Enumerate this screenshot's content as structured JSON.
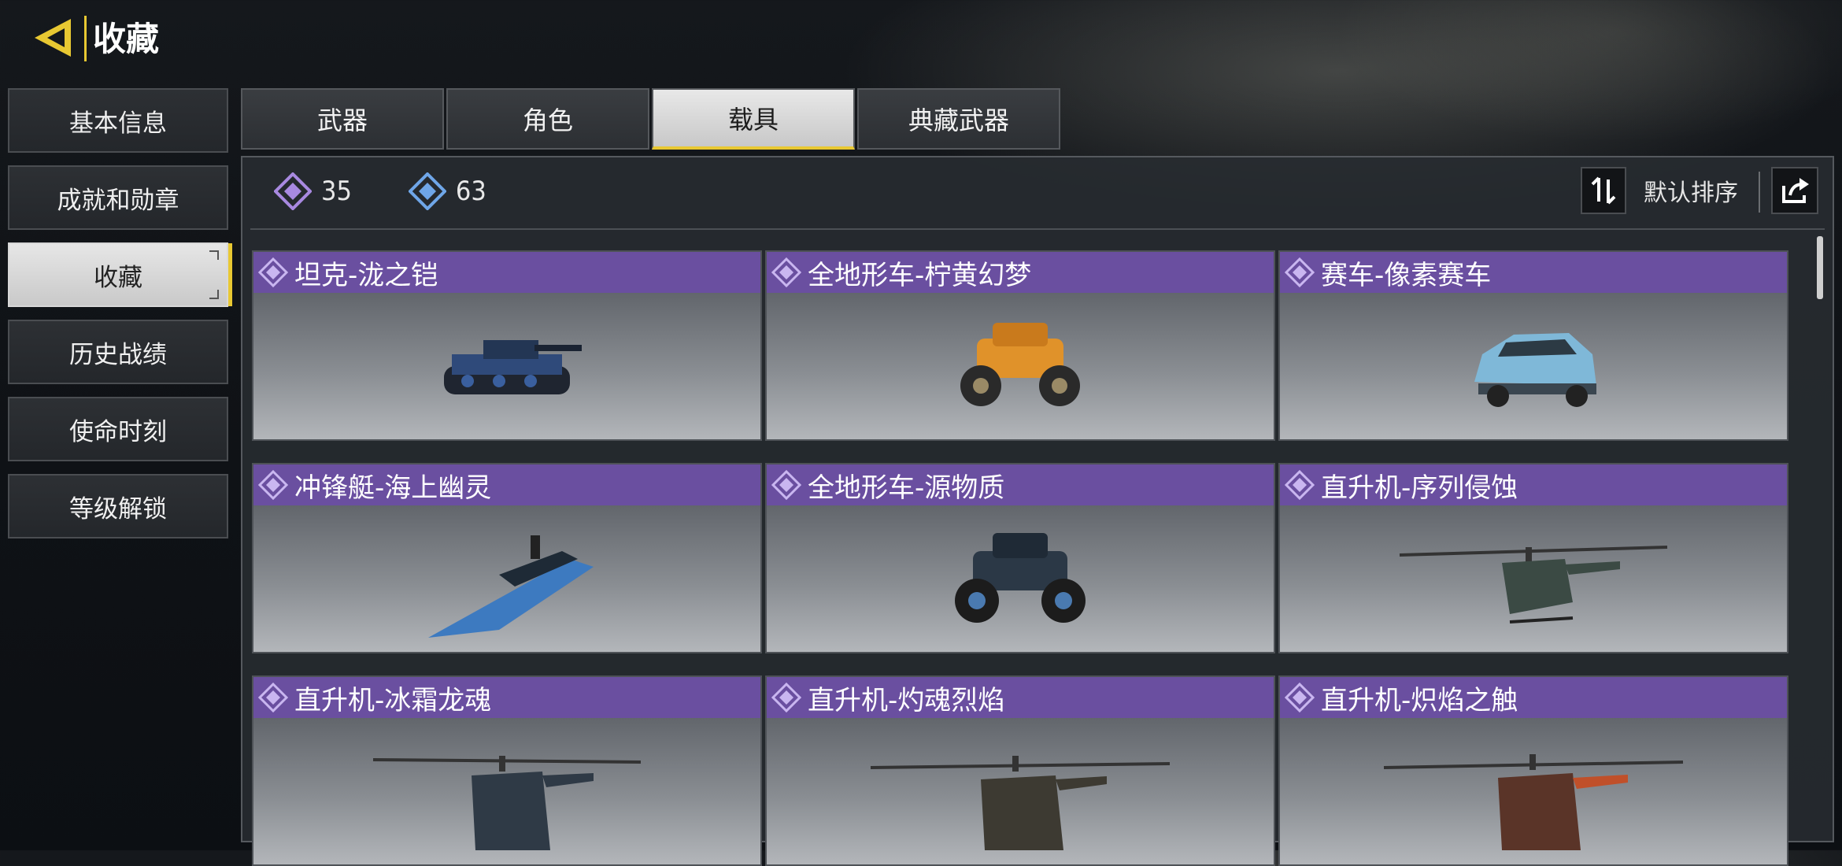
{
  "header": {
    "title": "收藏",
    "accent": "#e8c832"
  },
  "sidebar": {
    "items": [
      {
        "label": "基本信息",
        "active": false
      },
      {
        "label": "成就和勋章",
        "active": false
      },
      {
        "label": "收藏",
        "active": true
      },
      {
        "label": "历史战绩",
        "active": false
      },
      {
        "label": "使命时刻",
        "active": false
      },
      {
        "label": "等级解锁",
        "active": false
      }
    ]
  },
  "tabs": [
    {
      "label": "武器",
      "active": false
    },
    {
      "label": "角色",
      "active": false
    },
    {
      "label": "载具",
      "active": true
    },
    {
      "label": "典藏武器",
      "active": false
    }
  ],
  "currencies": [
    {
      "icon": "purple-diamond-icon",
      "value": "35",
      "color": "#a889e0"
    },
    {
      "icon": "blue-diamond-icon",
      "value": "63",
      "color": "#6fa6e8"
    }
  ],
  "sort": {
    "label": "默认排序"
  },
  "items": [
    {
      "name": "坦克-泷之铠",
      "vehicle": "tank",
      "rarity_color": "#6a4fa0"
    },
    {
      "name": "全地形车-柠黄幻梦",
      "vehicle": "atv-orange",
      "rarity_color": "#6a4fa0"
    },
    {
      "name": "赛车-像素赛车",
      "vehicle": "race-car",
      "rarity_color": "#6a4fa0"
    },
    {
      "name": "冲锋艇-海上幽灵",
      "vehicle": "boat",
      "rarity_color": "#6a4fa0"
    },
    {
      "name": "全地形车-源物质",
      "vehicle": "atv-dark",
      "rarity_color": "#6a4fa0"
    },
    {
      "name": "直升机-序列侵蚀",
      "vehicle": "helicopter-green",
      "rarity_color": "#6a4fa0"
    },
    {
      "name": "直升机-冰霜龙魂",
      "vehicle": "helicopter-blue",
      "rarity_color": "#6a4fa0"
    },
    {
      "name": "直升机-灼魂烈焰",
      "vehicle": "helicopter-gold",
      "rarity_color": "#6a4fa0"
    },
    {
      "name": "直升机-炽焰之触",
      "vehicle": "helicopter-red",
      "rarity_color": "#6a4fa0"
    }
  ]
}
